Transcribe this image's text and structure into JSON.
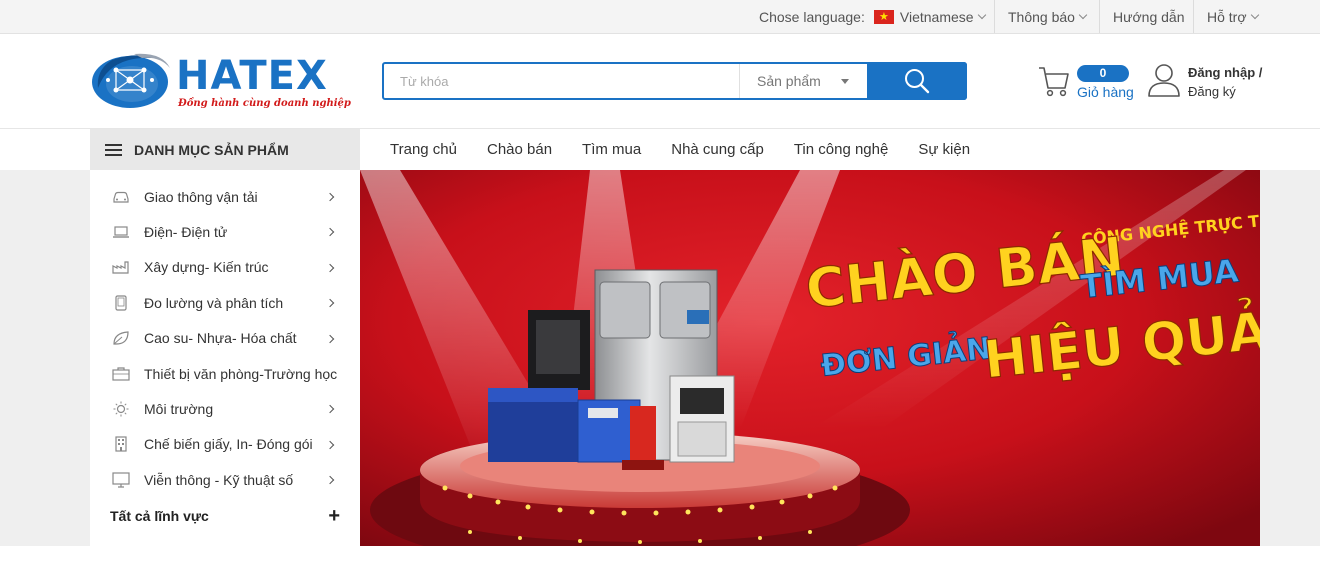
{
  "topbar": {
    "language_label": "Chose language:",
    "language_value": "Vietnamese",
    "notifications": "Thông báo",
    "guide": "Hướng dẫn",
    "support": "Hỗ trợ"
  },
  "logo": {
    "brand": "HATEX",
    "tagline": "Đồng hành cùng doanh nghiệp"
  },
  "search": {
    "placeholder": "Từ khóa",
    "category_selected": "Sản phẩm"
  },
  "cart": {
    "count": "0",
    "label": "Giỏ hàng"
  },
  "account": {
    "login": "Đăng nhập /",
    "register": "Đăng ký"
  },
  "nav": {
    "category_button": "DANH MỤC SẢN PHẨM",
    "links": [
      "Trang chủ",
      "Chào bán",
      "Tìm mua",
      "Nhà cung cấp",
      "Tin công nghệ",
      "Sự kiện"
    ]
  },
  "sidebar": {
    "items": [
      {
        "label": "Giao thông vận tải",
        "icon": "car-icon"
      },
      {
        "label": "Điện- Điện tử",
        "icon": "laptop-icon"
      },
      {
        "label": "Xây dựng- Kiến trúc",
        "icon": "factory-icon"
      },
      {
        "label": "Đo lường và phân tích",
        "icon": "tablet-icon"
      },
      {
        "label": "Cao su- Nhựa- Hóa chất",
        "icon": "leaf-icon"
      },
      {
        "label": "Thiết bị văn phòng-Trường học",
        "icon": "briefcase-icon"
      },
      {
        "label": "Môi trường",
        "icon": "sun-icon"
      },
      {
        "label": "Chế biến giấy, In- Đóng gói",
        "icon": "building-icon"
      },
      {
        "label": "Viễn thông - Kỹ thuật số",
        "icon": "monitor-icon"
      }
    ],
    "all_label": "Tất cả lĩnh vực",
    "all_icon": "plus-icon"
  },
  "banner": {
    "line_top_right": "CÔNG NGHỆ TRỰC TUYẾN",
    "line_big_left": "CHÀO BÁN",
    "line_right_blue": "TÌM MUA",
    "line_bottom_left": "ĐƠN GIẢN",
    "line_bottom_right": "HIỆU QUẢ"
  },
  "colors": {
    "brand_blue": "#1a72c4",
    "tagline_red": "#d21a1a",
    "banner_red": "#c8101a",
    "banner_yellow": "#ffd21f"
  }
}
